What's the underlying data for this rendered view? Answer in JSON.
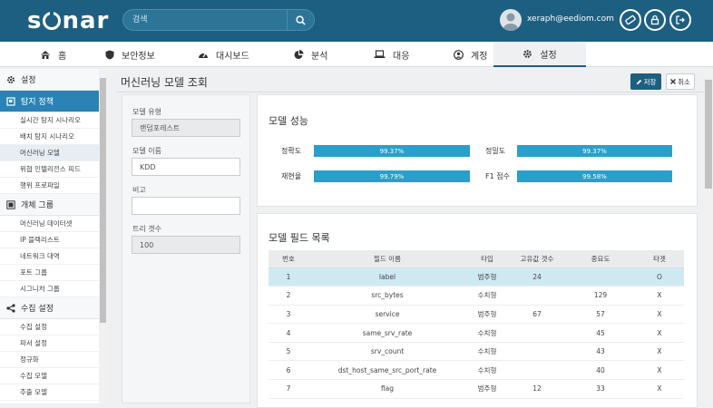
{
  "app": {
    "logo": "sonar"
  },
  "search": {
    "placeholder": "검색"
  },
  "user": {
    "email": "xeraph@eediom.com"
  },
  "nav": [
    {
      "label": "홈",
      "icon": "home-icon"
    },
    {
      "label": "보안정보",
      "icon": "shield-icon"
    },
    {
      "label": "대시보드",
      "icon": "dashboard-icon"
    },
    {
      "label": "분석",
      "icon": "pie-chart-icon"
    },
    {
      "label": "대응",
      "icon": "laptop-icon"
    },
    {
      "label": "계정",
      "icon": "user-circle-icon"
    },
    {
      "label": "설정",
      "icon": "gear-icon"
    }
  ],
  "sidebar": {
    "sections": [
      {
        "label": "설정",
        "icon": "gear-icon"
      },
      {
        "label": "탐지 정책",
        "icon": "flag-icon"
      },
      {
        "label": "개체 그룹",
        "icon": "group-icon"
      },
      {
        "label": "수집 설정",
        "icon": "share-icon"
      }
    ],
    "detection_items": [
      "실시간 탐지 시나리오",
      "배치 탐지 시나리오",
      "머신러닝 모델",
      "위협 인텔리전스 피드",
      "행위 프로파일"
    ],
    "group_items": [
      "머신러닝 데이터셋",
      "IP 블랙리스트",
      "네트워크 대역",
      "포트 그룹",
      "시그니처 그룹"
    ],
    "collect_items": [
      "수집 설정",
      "파서 설정",
      "정규화",
      "수집 모델",
      "추출 모델"
    ]
  },
  "page": {
    "title": "머신러닝 모델 조회",
    "save_label": "저장",
    "cancel_label": "취소"
  },
  "form": {
    "type_label": "모델 유형",
    "type_value": "랜덤포레스트",
    "name_label": "모델 이름",
    "name_value": "KDD",
    "note_label": "비고",
    "note_value": "",
    "trees_label": "트리 갯수",
    "trees_value": "100"
  },
  "performance": {
    "title": "모델 성능",
    "metrics": [
      {
        "label": "정확도",
        "value": "99.37%"
      },
      {
        "label": "정밀도",
        "value": "99.37%"
      },
      {
        "label": "재현율",
        "value": "99.79%"
      },
      {
        "label": "F1 점수",
        "value": "99.58%"
      }
    ]
  },
  "fields": {
    "title": "모델 필드 목록",
    "headers": [
      "번호",
      "필드 이름",
      "타입",
      "고유값 갯수",
      "중요도",
      "타겟"
    ],
    "rows": [
      [
        "1",
        "label",
        "범주형",
        "24",
        "",
        "O"
      ],
      [
        "2",
        "src_bytes",
        "수치형",
        "",
        "129",
        "X"
      ],
      [
        "3",
        "service",
        "범주형",
        "67",
        "57",
        "X"
      ],
      [
        "4",
        "same_srv_rate",
        "수치형",
        "",
        "45",
        "X"
      ],
      [
        "5",
        "srv_count",
        "수치형",
        "",
        "43",
        "X"
      ],
      [
        "6",
        "dst_host_same_src_port_rate",
        "수치형",
        "",
        "40",
        "X"
      ],
      [
        "7",
        "flag",
        "범주형",
        "12",
        "33",
        "X"
      ]
    ]
  },
  "colors": {
    "header": "#1d5f80",
    "accent": "#2a82b5",
    "bar": "#2a9fca"
  }
}
